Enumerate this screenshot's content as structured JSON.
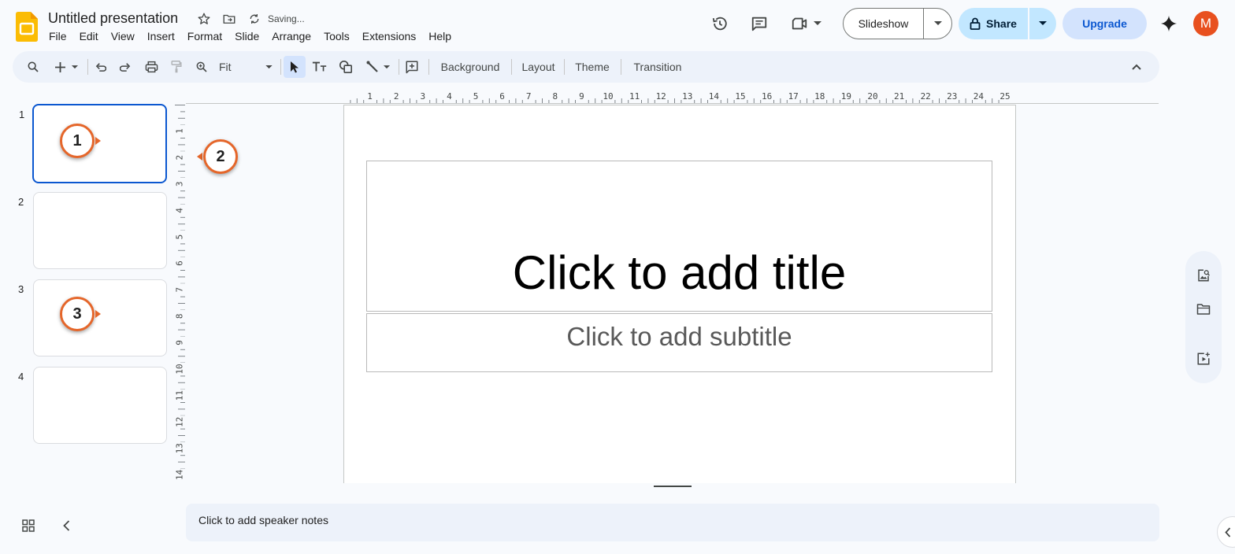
{
  "header": {
    "title": "Untitled presentation",
    "status": "Saving...",
    "menu": [
      "File",
      "Edit",
      "View",
      "Insert",
      "Format",
      "Slide",
      "Arrange",
      "Tools",
      "Extensions",
      "Help"
    ],
    "slideshow_label": "Slideshow",
    "share_label": "Share",
    "upgrade_label": "Upgrade",
    "avatar_initial": "M"
  },
  "toolbar": {
    "zoom_label": "Fit",
    "background_label": "Background",
    "layout_label": "Layout",
    "theme_label": "Theme",
    "transition_label": "Transition"
  },
  "filmstrip": {
    "slides": [
      {
        "number": "1",
        "selected": true
      },
      {
        "number": "2",
        "selected": false
      },
      {
        "number": "3",
        "selected": false
      },
      {
        "number": "4",
        "selected": false
      }
    ]
  },
  "ruler": {
    "horizontal": [
      "1",
      "2",
      "3",
      "4",
      "5",
      "6",
      "7",
      "8",
      "9",
      "10",
      "11",
      "12",
      "13",
      "14",
      "15",
      "16",
      "17",
      "18",
      "19",
      "20",
      "21",
      "22",
      "23",
      "24",
      "25"
    ],
    "vertical": [
      "1",
      "2",
      "3",
      "4",
      "5",
      "6",
      "7",
      "8",
      "9",
      "10",
      "11",
      "12",
      "13",
      "14"
    ]
  },
  "slide": {
    "title_placeholder": "Click to add title",
    "subtitle_placeholder": "Click to add subtitle"
  },
  "notes": {
    "placeholder": "Click to add speaker notes"
  },
  "markers": [
    "1",
    "2",
    "3"
  ],
  "colors": {
    "accent": "#0b57d0",
    "share_bg": "#c2e7ff",
    "upgrade_bg": "#d3e3fd",
    "avatar_bg": "#e8501f",
    "marker_border": "#e5662a",
    "logo": "#fbbc04"
  }
}
